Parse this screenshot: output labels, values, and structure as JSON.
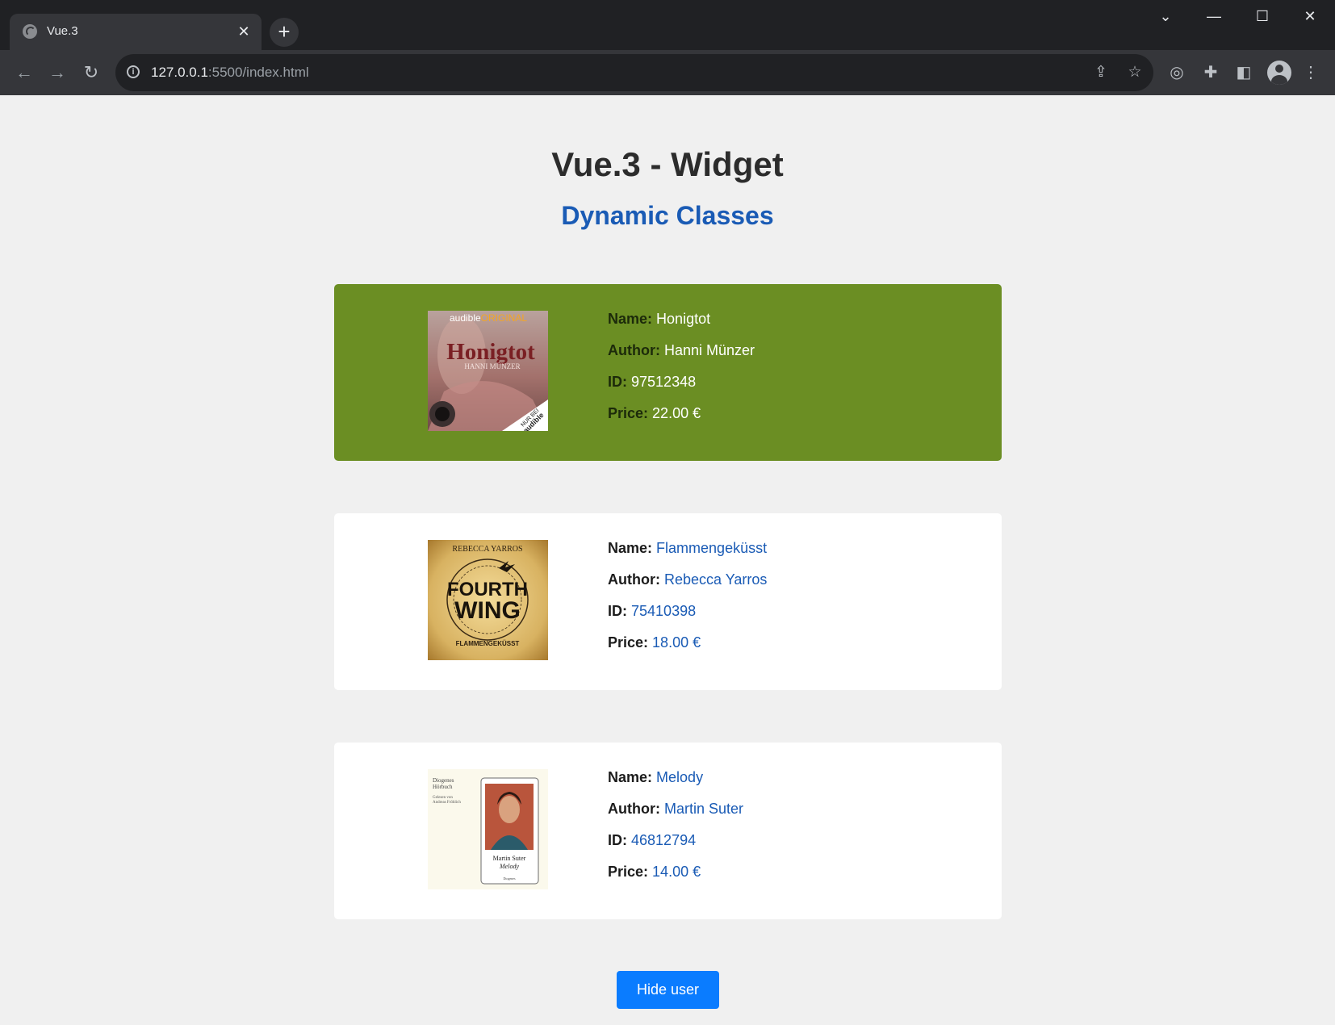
{
  "browser": {
    "tab_title": "Vue.3",
    "url_host": "127.0.0.1",
    "url_rest": ":5500/index.html"
  },
  "page": {
    "title": "Vue.3 - Widget",
    "subtitle": "Dynamic Classes",
    "labels": {
      "name": "Name:",
      "author": "Author:",
      "id": "ID:",
      "price": "Price:"
    },
    "books": [
      {
        "name": "Honigtot",
        "author": "Hanni Münzer",
        "id": "97512348",
        "price": "22.00 €",
        "highlighted": true
      },
      {
        "name": "Flammengeküsst",
        "author": "Rebecca Yarros",
        "id": "75410398",
        "price": "18.00 €",
        "highlighted": false
      },
      {
        "name": "Melody",
        "author": "Martin Suter",
        "id": "46812794",
        "price": "14.00 €",
        "highlighted": false
      }
    ],
    "covers": [
      {
        "brand": "audible",
        "brand_suffix": "ORIGINAL",
        "title": "Honigtot",
        "author_line": "HANNI MÜNZER",
        "badge_top": "NUR BEI",
        "badge_bottom": "audible"
      },
      {
        "author_line": "REBECCA YARROS",
        "title_top": "FOURTH",
        "title_bottom": "WING",
        "subtitle": "FLAMMENGEKÜSST"
      },
      {
        "publisher": "Diogenes",
        "series": "Hörbuch",
        "read_by": "Gelesen von",
        "reader": "Andreas Fröhlich",
        "author": "Martin Suter",
        "title": "Melody",
        "imprint": "Diogenes"
      }
    ],
    "hide_button_label": "Hide user",
    "accent_color": "#6b8e23",
    "button_color": "#0a7cff"
  }
}
